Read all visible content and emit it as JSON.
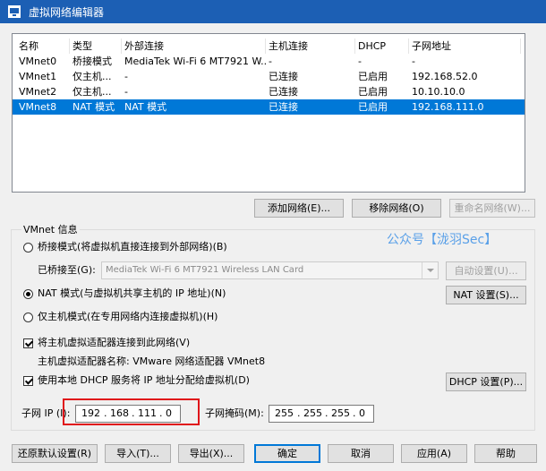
{
  "window": {
    "title": "虚拟网络编辑器"
  },
  "netlist": {
    "columns": [
      "名称",
      "类型",
      "外部连接",
      "主机连接",
      "DHCP",
      "子网地址"
    ],
    "rows": [
      [
        "VMnet0",
        "桥接模式",
        "MediaTek Wi-Fi 6 MT7921 W...",
        "-",
        "-",
        "-"
      ],
      [
        "VMnet1",
        "仅主机...",
        "-",
        "已连接",
        "已启用",
        "192.168.52.0"
      ],
      [
        "VMnet2",
        "仅主机...",
        "-",
        "已连接",
        "已启用",
        "10.10.10.0"
      ],
      [
        "VMnet8",
        "NAT 模式",
        "NAT 模式",
        "已连接",
        "已启用",
        "192.168.111.0"
      ]
    ],
    "selected_index": 3
  },
  "list_buttons": {
    "add": "添加网络(E)...",
    "remove": "移除网络(O)",
    "rename": "重命名网络(W)..."
  },
  "vmnet_info": {
    "label": "VMnet 信息",
    "bridged": {
      "label": "桥接模式(将虚拟机直接连接到外部网络)(B)",
      "selected": false
    },
    "bridged_to": {
      "label": "已桥接至(G):",
      "value": "MediaTek Wi-Fi 6 MT7921 Wireless LAN Card",
      "auto_button": "自动设置(U)..."
    },
    "nat": {
      "label": "NAT 模式(与虚拟机共享主机的 IP 地址)(N)",
      "selected": true,
      "settings_button": "NAT 设置(S)..."
    },
    "hostonly": {
      "label": "仅主机模式(在专用网络内连接虚拟机)(H)",
      "selected": false
    },
    "connect_adapter": {
      "label": "将主机虚拟适配器连接到此网络(V)",
      "checked": true
    },
    "adapter_name": "主机虚拟适配器名称: VMware 网络适配器 VMnet8",
    "dhcp": {
      "label": "使用本地 DHCP 服务将 IP 地址分配给虚拟机(D)",
      "checked": true,
      "settings_button": "DHCP 设置(P)..."
    },
    "subnet_ip": {
      "label": "子网 IP (I):",
      "octets": [
        "192",
        "168",
        "111",
        "0"
      ]
    },
    "subnet_mask": {
      "label": "子网掩码(M):",
      "octets": [
        "255",
        "255",
        "255",
        "0"
      ]
    }
  },
  "watermark": "公众号【泷羽Sec】",
  "footer": {
    "restore": "还原默认设置(R)",
    "import": "导入(T)...",
    "export": "导出(X)...",
    "ok": "确定",
    "cancel": "取消",
    "apply": "应用(A)",
    "help": "帮助"
  },
  "colors": {
    "titlebar": "#1c5fb4",
    "selection": "#0078d7",
    "highlight_box": "#e0151a"
  }
}
